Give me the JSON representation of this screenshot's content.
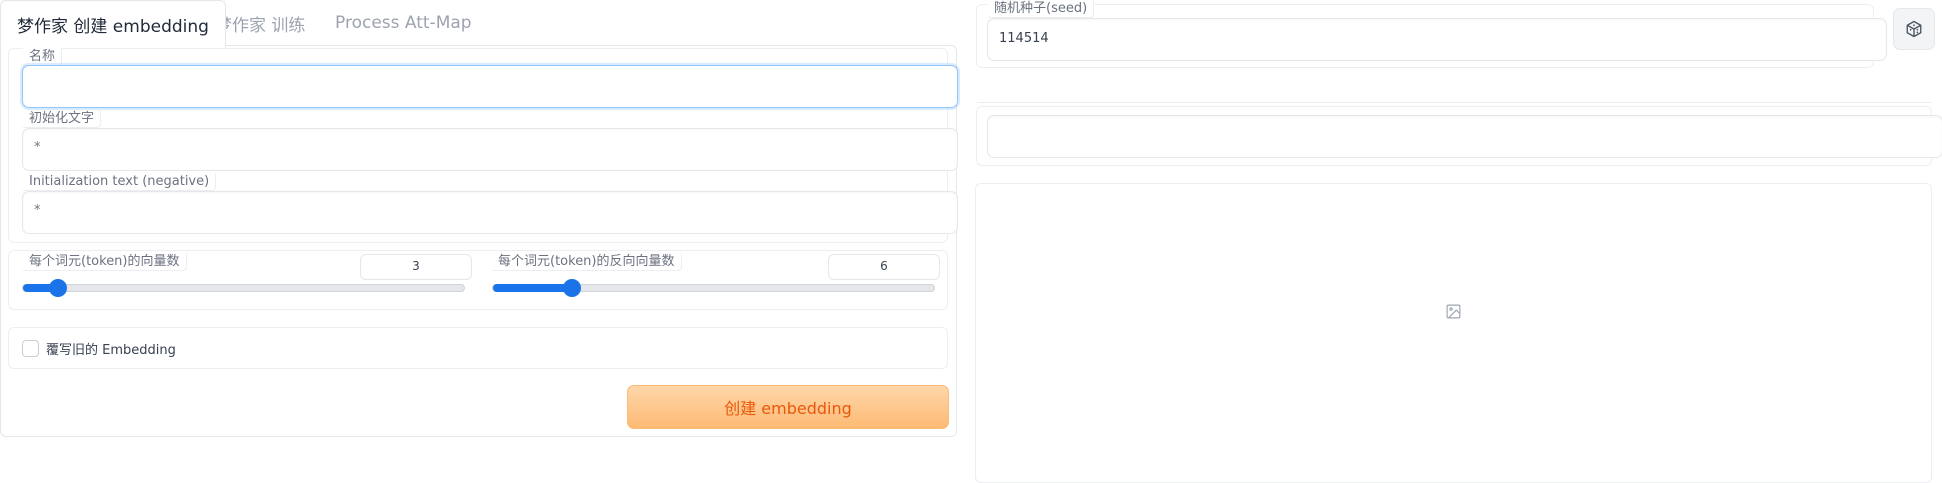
{
  "tabs": [
    {
      "label": "梦作家 创建 embedding",
      "active": true
    },
    {
      "label": "梦作家 训练",
      "active": false
    },
    {
      "label": "Process Att-Map",
      "active": false
    }
  ],
  "form": {
    "name": {
      "label": "名称",
      "value": ""
    },
    "init_text": {
      "label": "初始化文字",
      "value": "*"
    },
    "init_text_negative": {
      "label": "Initialization text (negative)",
      "value": "*"
    },
    "vectors_per_token": {
      "label": "每个词元(token)的向量数",
      "value": "3",
      "fraction": 0.08
    },
    "negative_vectors_per_token": {
      "label": "每个词元(token)的反向向量数",
      "value": "6",
      "fraction": 0.18
    },
    "overwrite": {
      "label": "覆写旧的 Embedding",
      "checked": false
    },
    "create_button": "创建 embedding"
  },
  "seed": {
    "label": "随机种子(seed)",
    "value": "114514",
    "button_icon": "dice-icon"
  },
  "output": {
    "text_value": "",
    "image_icon": "image-placeholder-icon"
  },
  "colors": {
    "accent": "#1a73e8",
    "primary_button": "#fdba74",
    "primary_text": "#ea580c"
  }
}
